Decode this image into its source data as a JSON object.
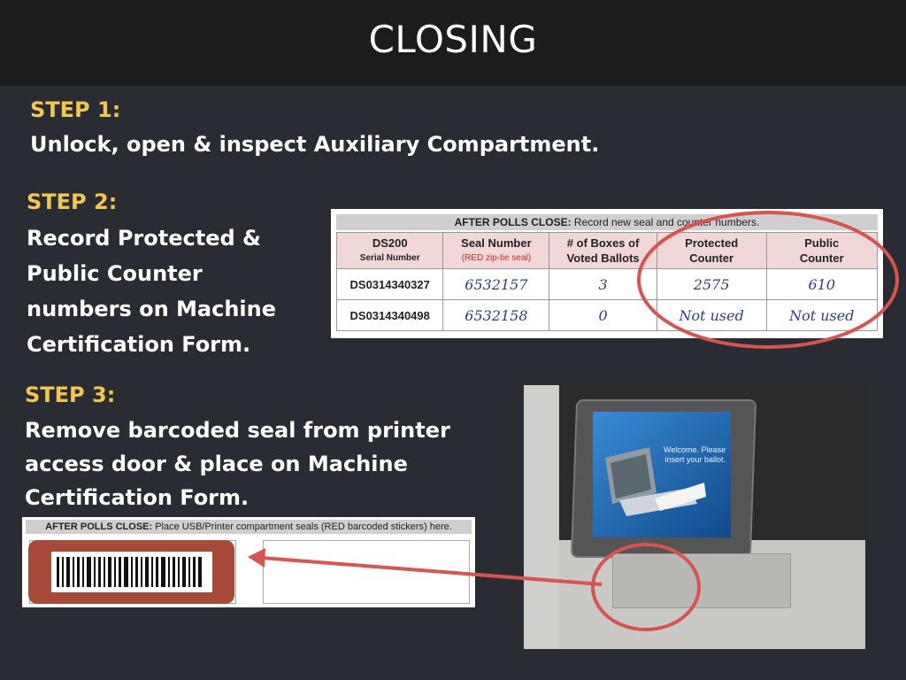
{
  "title": "CLOSING",
  "step1": {
    "label": "STEP 1:",
    "text": "Unlock, open & inspect Auxiliary Compartment."
  },
  "step2": {
    "label": "STEP 2:",
    "lines": [
      "Record Protected &",
      "Public Counter",
      "numbers on Machine",
      "Certification Form."
    ]
  },
  "step3": {
    "label": "STEP 3:",
    "lines": [
      "Remove barcoded seal from printer",
      "access door & place on Machine",
      "Certification Form."
    ]
  },
  "form1": {
    "header_bold": "AFTER POLLS CLOSE:",
    "header_rest": " Record new seal and counter numbers.",
    "columns": [
      {
        "title": "DS200",
        "sub": "Serial Number"
      },
      {
        "title": "Seal Number",
        "sub": "(RED zip-tie seal)"
      },
      {
        "title": "# of Boxes of",
        "sub": "Voted Ballots"
      },
      {
        "title": "Protected",
        "sub": "Counter"
      },
      {
        "title": "Public",
        "sub": "Counter"
      }
    ],
    "rows": [
      [
        "DS0314340327",
        "6532157",
        "3",
        "2575",
        "610"
      ],
      [
        "DS0314340498",
        "6532158",
        "0",
        "Not used",
        "Not used"
      ]
    ]
  },
  "form2": {
    "header_bold": "AFTER POLLS CLOSE:",
    "header_rest": " Place USB/Printer compartment seals (RED barcoded stickers) here."
  },
  "photo": {
    "screen_text": "Welcome. Please insert your ballot."
  },
  "colors": {
    "accent": "#f2c84b",
    "highlight": "#d9534f",
    "background": "#2a2c33"
  }
}
